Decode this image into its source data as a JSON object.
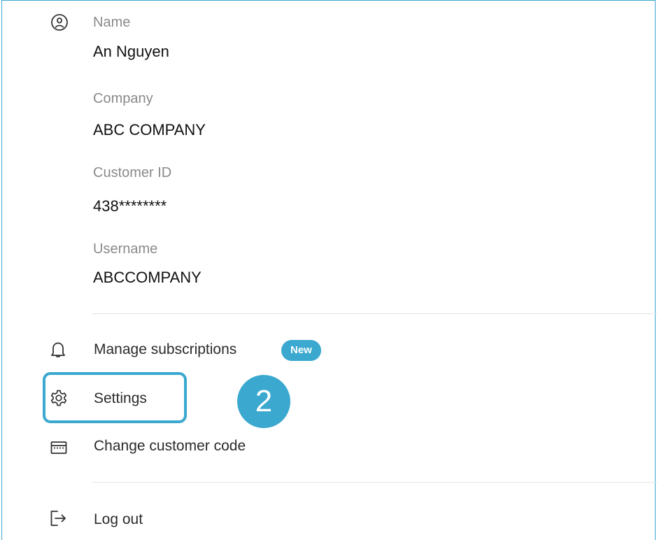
{
  "profile": {
    "name_label": "Name",
    "name_value": "An Nguyen",
    "company_label": "Company",
    "company_value": "ABC COMPANY",
    "customer_id_label": "Customer ID",
    "customer_id_value": "438********",
    "username_label": "Username",
    "username_value": "ABCCOMPANY"
  },
  "menu": {
    "manage_subscriptions": "Manage subscriptions",
    "new_badge": "New",
    "settings": "Settings",
    "change_customer_code": "Change customer code",
    "log_out": "Log out"
  },
  "annotation": {
    "step_number": "2"
  },
  "colors": {
    "accent": "#3aa8cf"
  },
  "icons": [
    "user-icon",
    "bell-icon",
    "gear-icon",
    "card-icon",
    "logout-icon"
  ]
}
